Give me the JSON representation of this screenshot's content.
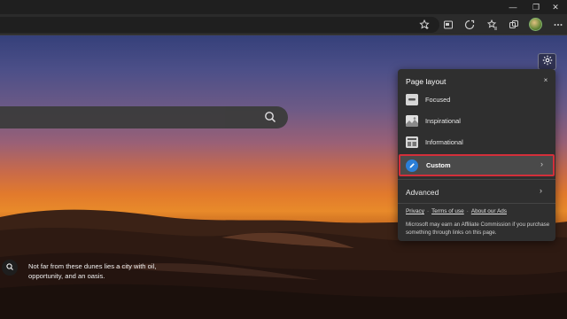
{
  "browser": {
    "window_controls": [
      "—",
      "❐",
      "✕"
    ],
    "toolbar_icons": [
      "add-favorite-icon",
      "immersive-reader-icon",
      "extensions-icon",
      "favorites-icon",
      "collections-icon",
      "profile-avatar",
      "more-icon"
    ]
  },
  "search": {
    "placeholder": ""
  },
  "caption": {
    "text": "Not far from these dunes lies a city with oil, opportunity, and an oasis."
  },
  "panel": {
    "title": "Page layout",
    "close": "×",
    "options": [
      {
        "label": "Focused",
        "icon": "focused-layout-icon"
      },
      {
        "label": "Inspirational",
        "icon": "inspirational-layout-icon"
      },
      {
        "label": "Informational",
        "icon": "informational-layout-icon"
      }
    ],
    "custom": {
      "label": "Custom",
      "icon": "pencil-icon",
      "highlight": "#d32f3a"
    },
    "advanced": {
      "label": "Advanced"
    },
    "links": [
      "Privacy",
      "Terms of use",
      "About our Ads"
    ],
    "separator": "·",
    "disclaimer": "Microsoft may earn an Affiliate Commission if you purchase something through links on this page."
  },
  "colors": {
    "accent": "#2b7fd8",
    "highlight_border": "#d32f3a",
    "panel_bg": "#2f2f2f"
  }
}
